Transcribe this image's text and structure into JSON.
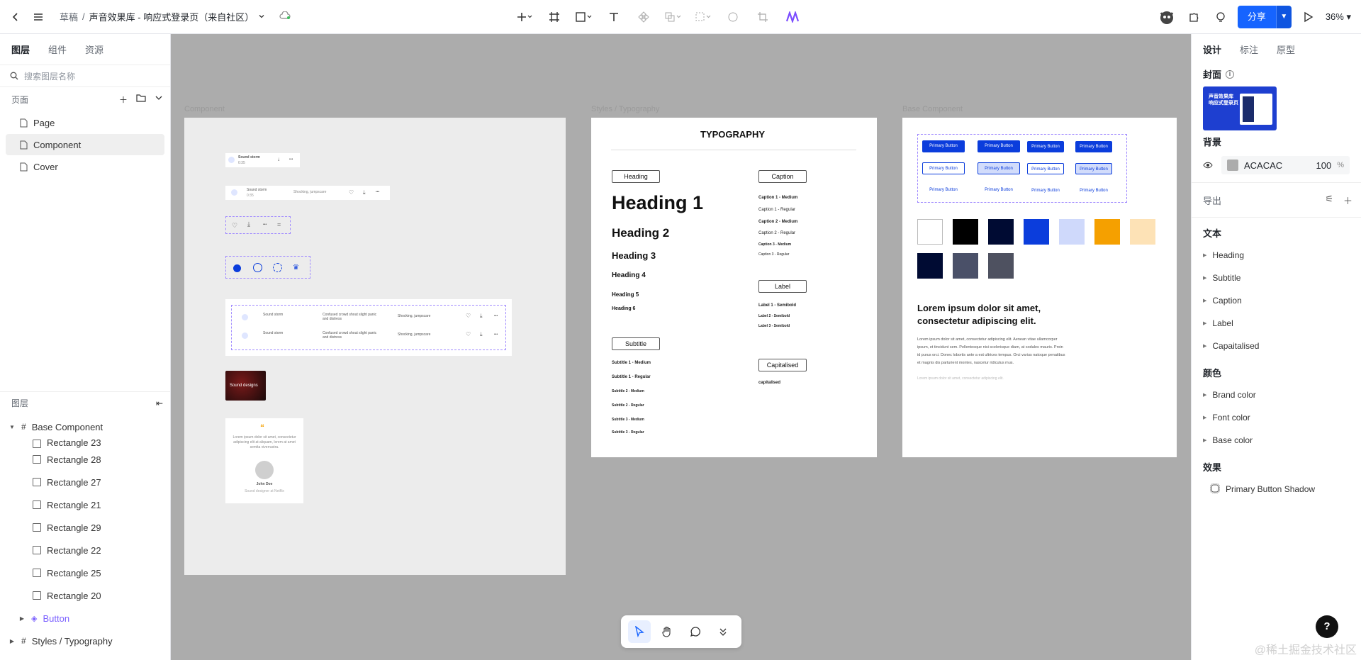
{
  "topbar": {
    "breadcrumb_root": "草稿",
    "breadcrumb_sep": "/",
    "file_name": "声音效果库 - 响应式登录页（来自社区）",
    "share_label": "分享",
    "zoom": "36%"
  },
  "left": {
    "tabs": [
      "图层",
      "组件",
      "资源"
    ],
    "search_placeholder": "搜索图层名称",
    "pages_title": "页面",
    "pages": [
      "Page",
      "Component",
      "Cover"
    ],
    "layers_title": "图层",
    "layers": [
      {
        "label": "Base Component",
        "type": "frame"
      },
      {
        "label": "Rectangle 23",
        "type": "rect"
      },
      {
        "label": "Rectangle 28",
        "type": "rect"
      },
      {
        "label": "Rectangle 27",
        "type": "rect"
      },
      {
        "label": "Rectangle 21",
        "type": "rect"
      },
      {
        "label": "Rectangle 29",
        "type": "rect"
      },
      {
        "label": "Rectangle 22",
        "type": "rect"
      },
      {
        "label": "Rectangle 25",
        "type": "rect"
      },
      {
        "label": "Rectangle 20",
        "type": "rect"
      },
      {
        "label": "Button",
        "type": "component"
      },
      {
        "label": "Styles / Typography",
        "type": "frame"
      }
    ]
  },
  "right": {
    "tabs": [
      "设计",
      "标注",
      "原型"
    ],
    "cover_title": "封面",
    "cover_text": "声音效果库\n响应式登录页",
    "background_title": "背景",
    "bg_hex": "ACACAC",
    "bg_opacity": "100",
    "bg_percent": "%",
    "export_title": "导出",
    "text_title": "文本",
    "text_styles": [
      "Heading",
      "Subtitle",
      "Caption",
      "Label",
      "Capaitalised"
    ],
    "color_title": "颜色",
    "color_styles": [
      "Brand color",
      "Font color",
      "Base color"
    ],
    "effect_title": "效果",
    "effect_name": "Primary Button Shadow"
  },
  "canvas": {
    "frame_labels": [
      "Component",
      "Styles / Typography",
      "Base Component"
    ],
    "component": {
      "track_title": "Sound storm",
      "track_sub": "0:35",
      "track_desc": "Confused crowd shout slight panic and distress",
      "track_tag": "Shocking, jumpscare",
      "card_label": "Sound designs",
      "quote_text": "Lorem ipsum dolor sit amet, consectetur adipiscing elit at aliquam, lorem at amet semita viverrastra.",
      "quote_name": "John Doe",
      "quote_role": "Sound designer at Netflix"
    },
    "typography": {
      "title": "TYPOGRAPHY",
      "heading_tag": "Heading",
      "headings": [
        "Heading 1",
        "Heading 2",
        "Heading 3",
        "Heading 4",
        "Heading 5",
        "Heading 6"
      ],
      "caption_tag": "Caption",
      "captions": [
        "Caption 1 - Medium",
        "Caption 1 - Regular",
        "Caption 2 - Medium",
        "Caption 2 - Regular",
        "Caption 3 - Medium",
        "Caption 3 - Regular"
      ],
      "label_tag": "Label",
      "labels": [
        "Label 1 - Semibold",
        "Label 2 - Semibold",
        "Label 3 - Semibold"
      ],
      "subtitle_tag": "Subtitle",
      "subtitles": [
        "Subtitle 1 - Medium",
        "Subtitle 1 - Regular",
        "Subtitle 2 - Medium",
        "Subtitle 2 - Regular",
        "Subtitle 3 - Medium",
        "Subtitle 3 - Regular"
      ],
      "cap_tag": "Capitalised",
      "cap_text": "capitalised"
    },
    "base": {
      "button_label": "Primary Button",
      "swatches": [
        "#ffffff",
        "#000000",
        "#000b33",
        "#0b3ddc",
        "#cfd9fb",
        "#f5a000",
        "#fde2b6",
        "#000b33",
        "#4a5068",
        "#4e5160"
      ],
      "lorem_title": "Lorem ipsum dolor sit amet, consectetur adipiscing elit.",
      "lorem_body": "Lorem ipsum dolor sit amet, consectetur adipiscing elit. Aenean vitae ullamcorper ipsum, et tincidunt sem. Pellentesque nisi scelerisque diam, at sodales mauris. Proin id purus orci. Donec lobortis ante a est ultrices tempus. Orci varius natoque penatibus et magnis dis parturient montes, nascetur ridiculus mus.",
      "lorem_foot": "Lorem ipsum dolor sit amet, consectetur adipiscing elit."
    }
  },
  "watermark": "@稀土掘金技术社区",
  "help": "?"
}
